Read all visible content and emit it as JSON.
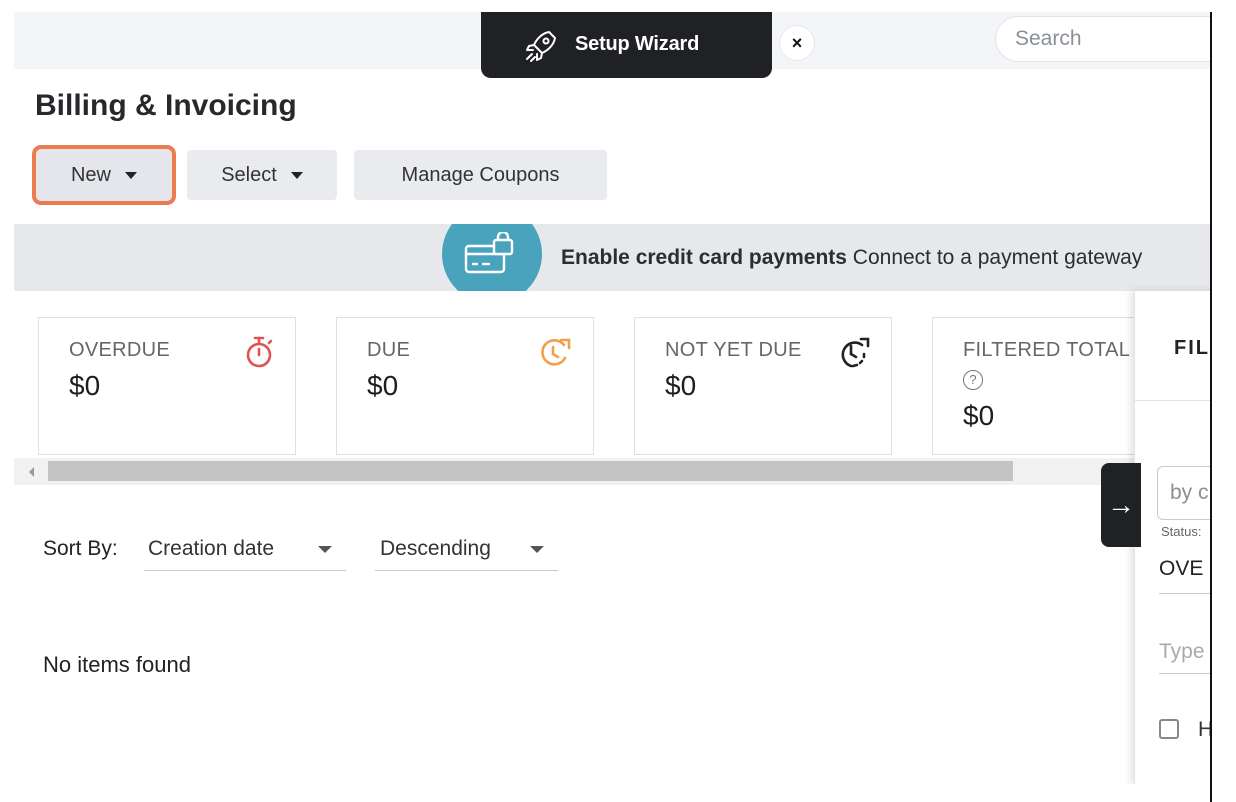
{
  "header": {
    "wizard_label": "Setup Wizard",
    "close_glyph": "×",
    "search_placeholder": "Search"
  },
  "page": {
    "title": "Billing & Invoicing"
  },
  "toolbar": {
    "new_label": "New",
    "select_label": "Select",
    "coupons_label": "Manage Coupons"
  },
  "banner": {
    "bold_text": "Enable credit card payments",
    "text": "Connect to a payment gateway",
    "icon": "credit-card-lock-icon"
  },
  "summary_cards": [
    {
      "label": "OVERDUE",
      "value": "$0",
      "icon": "stopwatch-icon",
      "color": "#e0514f"
    },
    {
      "label": "DUE",
      "value": "$0",
      "icon": "clock-alert-icon",
      "color": "#f0a04b"
    },
    {
      "label": "NOT YET DUE",
      "value": "$0",
      "icon": "clock-refresh-icon",
      "color": "#222222"
    },
    {
      "label": "FILTERED TOTAL",
      "value": "$0",
      "icon": "help-circle-icon",
      "color": "#777777"
    }
  ],
  "sort": {
    "label": "Sort By:",
    "field": "Creation date",
    "order": "Descending"
  },
  "list": {
    "empty_text": "No items found"
  },
  "filter_panel": {
    "title": "FIL",
    "search_placeholder": "by c",
    "status_label": "Status:",
    "status_value": "OVE",
    "type_placeholder": "Type",
    "checkbox_label": "H",
    "toggle_glyph": "→"
  },
  "colors": {
    "accent_highlight": "#ec7c4f",
    "banner_icon_bg": "#4aa3bd",
    "wizard_bg": "#202124"
  }
}
